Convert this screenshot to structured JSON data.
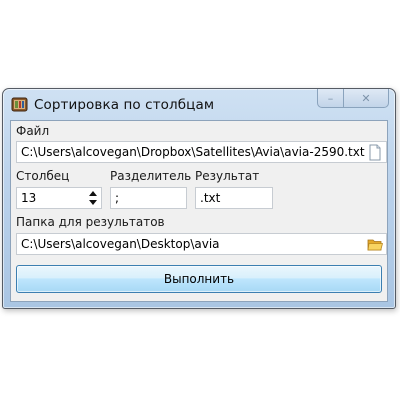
{
  "window": {
    "title": "Сортировка по столбцам",
    "minimize_symbol": "–",
    "close_symbol": "✕"
  },
  "file": {
    "label": "Файл",
    "value": "C:\\Users\\alcovegan\\Dropbox\\Satellites\\Avia\\avia-2590.txt",
    "icon": "document-icon"
  },
  "column": {
    "label": "Столбец",
    "value": "13"
  },
  "separator": {
    "label": "Разделитель",
    "value": ";"
  },
  "result": {
    "label": "Результат",
    "value": ".txt"
  },
  "output_folder": {
    "label": "Папка для результатов",
    "value": "C:\\Users\\alcovegan\\Desktop\\avia",
    "icon": "folder-icon"
  },
  "run_button": {
    "label": "Выполнить"
  },
  "colors": {
    "accent": "#3c7fb1",
    "folder": "#f2c43c"
  }
}
